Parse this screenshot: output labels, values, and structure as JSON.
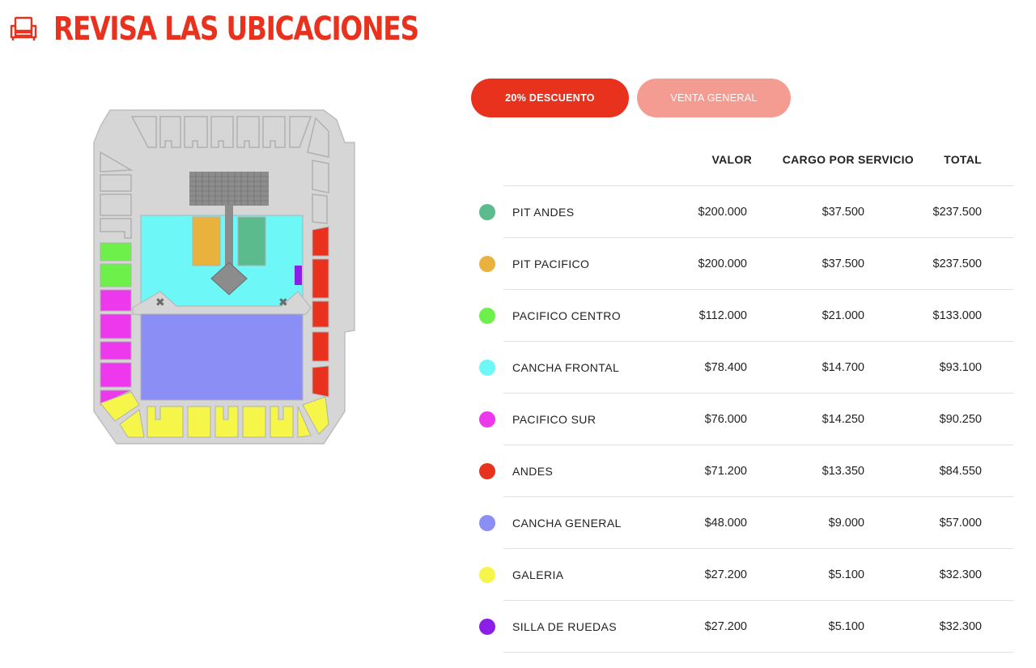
{
  "header": {
    "title": "REVISA LAS UBICACIONES",
    "icon": "seat-icon",
    "color": "#e8321e"
  },
  "tabs": [
    {
      "label": "20% DESCUENTO",
      "active": true,
      "color": "#e8321e"
    },
    {
      "label": "VENTA GENERAL",
      "active": false,
      "color": "#f59c92"
    }
  ],
  "table": {
    "columns": [
      "VALOR",
      "CARGO POR SERVICIO",
      "TOTAL"
    ],
    "rows": [
      {
        "name": "PIT ANDES",
        "color": "#5bbb8c",
        "valor": "$200.000",
        "cargo": "$37.500",
        "total": "$237.500"
      },
      {
        "name": "PIT PACIFICO",
        "color": "#e8b23c",
        "valor": "$200.000",
        "cargo": "$37.500",
        "total": "$237.500"
      },
      {
        "name": "PACIFICO CENTRO",
        "color": "#6ef04a",
        "valor": "$112.000",
        "cargo": "$21.000",
        "total": "$133.000"
      },
      {
        "name": "CANCHA FRONTAL",
        "color": "#6ef7f7",
        "valor": "$78.400",
        "cargo": "$14.700",
        "total": "$93.100"
      },
      {
        "name": "PACIFICO SUR",
        "color": "#ee38ee",
        "valor": "$76.000",
        "cargo": "$14.250",
        "total": "$90.250"
      },
      {
        "name": "ANDES",
        "color": "#e8321e",
        "valor": "$71.200",
        "cargo": "$13.350",
        "total": "$84.550"
      },
      {
        "name": "CANCHA GENERAL",
        "color": "#8b8ff5",
        "valor": "$48.000",
        "cargo": "$9.000",
        "total": "$57.000"
      },
      {
        "name": "GALERIA",
        "color": "#f5f54a",
        "valor": "$27.200",
        "cargo": "$5.100",
        "total": "$32.300"
      },
      {
        "name": "SILLA DE RUEDAS",
        "color": "#8b1fe8",
        "valor": "$27.200",
        "cargo": "$5.100",
        "total": "$32.300"
      }
    ]
  }
}
